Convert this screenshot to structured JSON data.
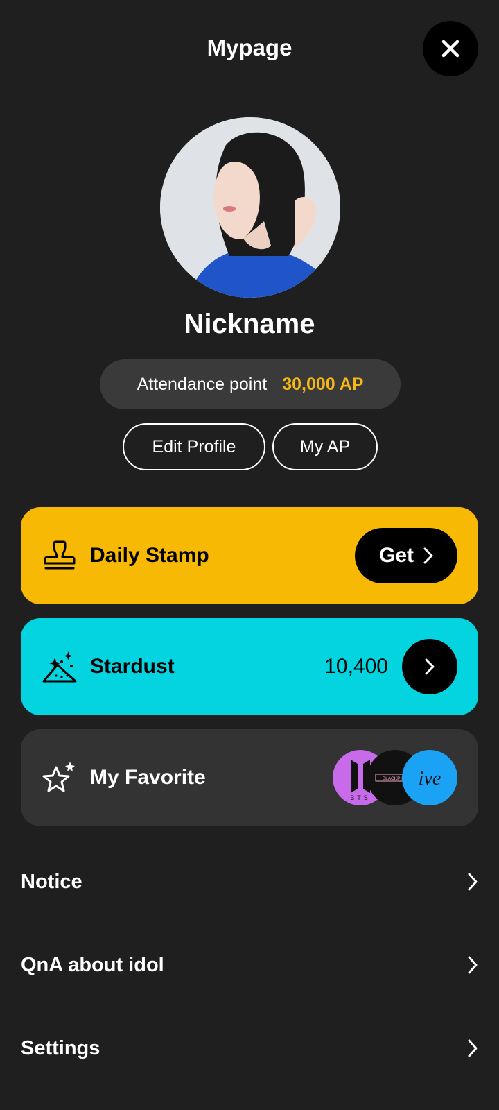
{
  "header": {
    "title": "Mypage"
  },
  "profile": {
    "nickname": "Nickname",
    "attendance_label": "Attendance point",
    "attendance_value": "30,000 AP",
    "edit_profile_label": "Edit Profile",
    "my_ap_label": "My AP"
  },
  "cards": {
    "daily_stamp": {
      "label": "Daily Stamp",
      "button_label": "Get"
    },
    "stardust": {
      "label": "Stardust",
      "value": "10,400"
    },
    "favorite": {
      "label": "My Favorite",
      "groups": [
        {
          "name": "BTS",
          "color": "#c86bea"
        },
        {
          "name": "BLACKPINK",
          "color": "#111111"
        },
        {
          "name": "ive",
          "color": "#1aa3f5"
        }
      ]
    }
  },
  "menu": [
    {
      "label": "Notice"
    },
    {
      "label": "QnA about idol"
    },
    {
      "label": "Settings"
    }
  ],
  "colors": {
    "background": "#1f1f1f",
    "stamp_card": "#f8b905",
    "stardust_card": "#03d4e0",
    "favorite_card": "#333333",
    "ap_accent": "#f5b816"
  },
  "icons": [
    "close-icon",
    "stamp-icon",
    "stardust-icon",
    "star-icon",
    "chevron-right-icon"
  ]
}
